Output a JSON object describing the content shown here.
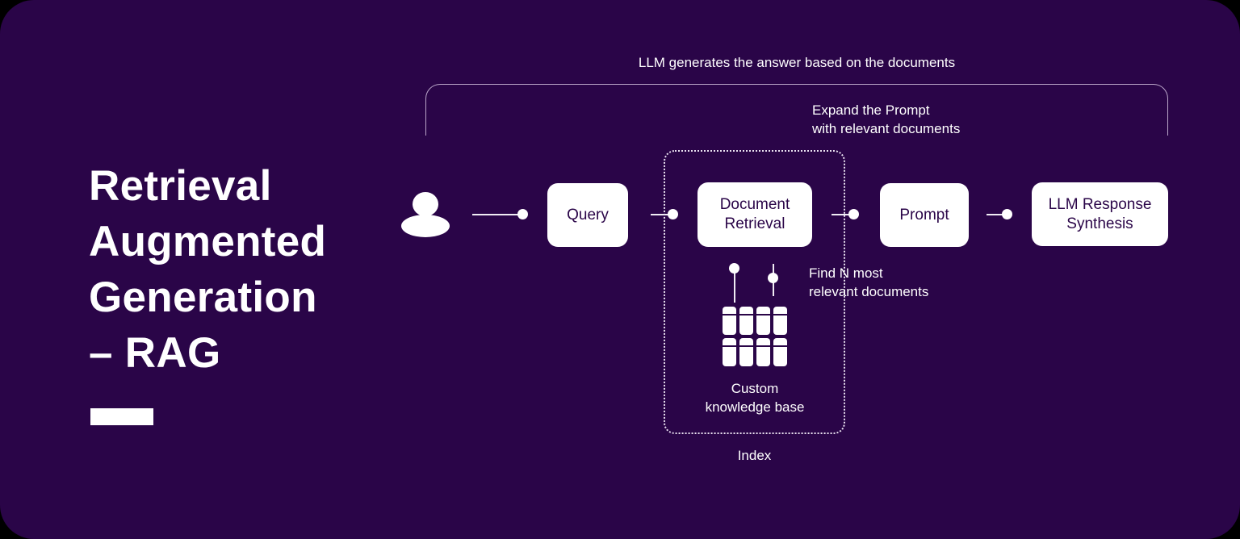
{
  "theme": {
    "page_background": "#000000",
    "card_background": "#2a0548",
    "box_fill": "#ffffff",
    "box_text": "#2a0548",
    "text": "#ffffff",
    "bracket_stroke": "#b9a5c8",
    "connector": "#f0ecf4"
  },
  "title": {
    "heading": "Retrieval\nAugmented\nGeneration\n– RAG"
  },
  "captions": {
    "top": "LLM generates the answer based on the documents",
    "expand": "Expand the Prompt\nwith relevant documents",
    "find": "Find N most\nrelevant documents"
  },
  "flow": {
    "actor_label": "user",
    "boxes": [
      {
        "id": "query",
        "label": "Query"
      },
      {
        "id": "document_retrieval",
        "label": "Document\nRetrieval"
      },
      {
        "id": "prompt",
        "label": "Prompt"
      },
      {
        "id": "llm_response_synthesis",
        "label": "LLM Response\nSynthesis"
      }
    ]
  },
  "index": {
    "label": "Index",
    "knowledge_base_label": "Custom\nknowledge base",
    "documents_icon": {
      "name": "documents-grid-icon",
      "columns": 4,
      "rows": 2,
      "count": 8
    }
  }
}
